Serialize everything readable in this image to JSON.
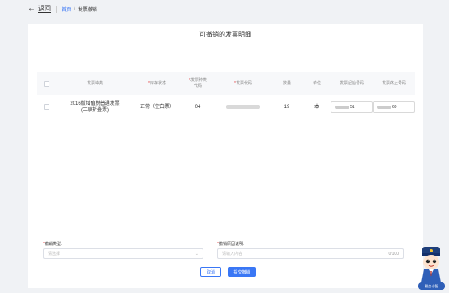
{
  "nav": {
    "back_arrow": "←",
    "back_label": "返回",
    "breadcrumb_home": "首页",
    "breadcrumb_sep": "/",
    "breadcrumb_current": "发票撤销"
  },
  "panel": {
    "title": "可撤销的发票明细"
  },
  "table": {
    "headers": {
      "type": "发票种类",
      "stock_status_req": "*",
      "stock_status": "库存状态",
      "type_code_req": "*",
      "type_code_1": "发票种类",
      "type_code_2": "代码",
      "invoice_code_req": "*",
      "invoice_code": "发票代码",
      "quantity": "数量",
      "unit": "单位",
      "start_no": "发票起始号码",
      "end_no": "发票终止号码"
    },
    "rows": [
      {
        "type_line1": "2016版增值税普通发票",
        "type_line2": "(二联折叠票)",
        "stock_status": "正常（空白票）",
        "type_code": "04",
        "quantity": "19",
        "unit": "本",
        "start_no_suffix": "51",
        "end_no_suffix": "69"
      }
    ]
  },
  "form": {
    "cancel_type_req": "*",
    "cancel_type_label": "撤销类型:",
    "cancel_type_placeholder": "请选择",
    "chevron": "⌄",
    "reason_req": "*",
    "reason_label": "撤销原因说明:",
    "reason_placeholder": "请输入内容",
    "reason_counter": "0/100"
  },
  "buttons": {
    "cancel": "取消",
    "submit": "提交撤销"
  },
  "assistant": {
    "badge": "税务小智"
  },
  "colors": {
    "accent": "#3a77f5",
    "required": "#e03c3c"
  }
}
